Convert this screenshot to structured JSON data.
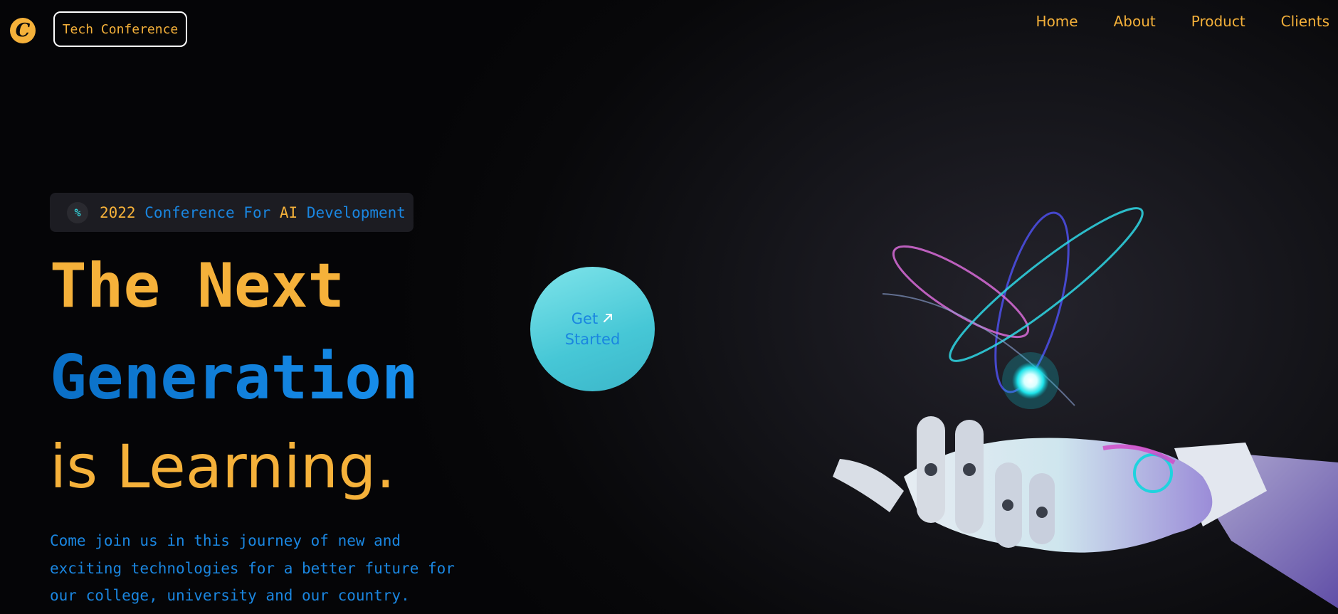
{
  "header": {
    "logo_letter": "C",
    "brand": "Tech Conference",
    "nav": [
      {
        "label": "Home"
      },
      {
        "label": "About"
      },
      {
        "label": "Product"
      },
      {
        "label": "Clients"
      }
    ]
  },
  "hero": {
    "badge": {
      "icon": "percent-icon",
      "year": "2022",
      "part1": "Conference For",
      "part2": "AI",
      "part3": "Development"
    },
    "headline_line1": "The Next",
    "headline_line2": "Generation",
    "headline_line3": "is Learning.",
    "description": "Come join us in this journey of new and exciting technologies for a better future for our college, university and our country.",
    "cta": {
      "line1": "Get",
      "line2": "Started",
      "icon": "arrow-up-right-icon"
    }
  },
  "colors": {
    "accent_yellow": "#f5b13a",
    "accent_blue": "#1a86e0",
    "cta_cyan": "#5fd3de",
    "background": "#0a0a0c"
  }
}
